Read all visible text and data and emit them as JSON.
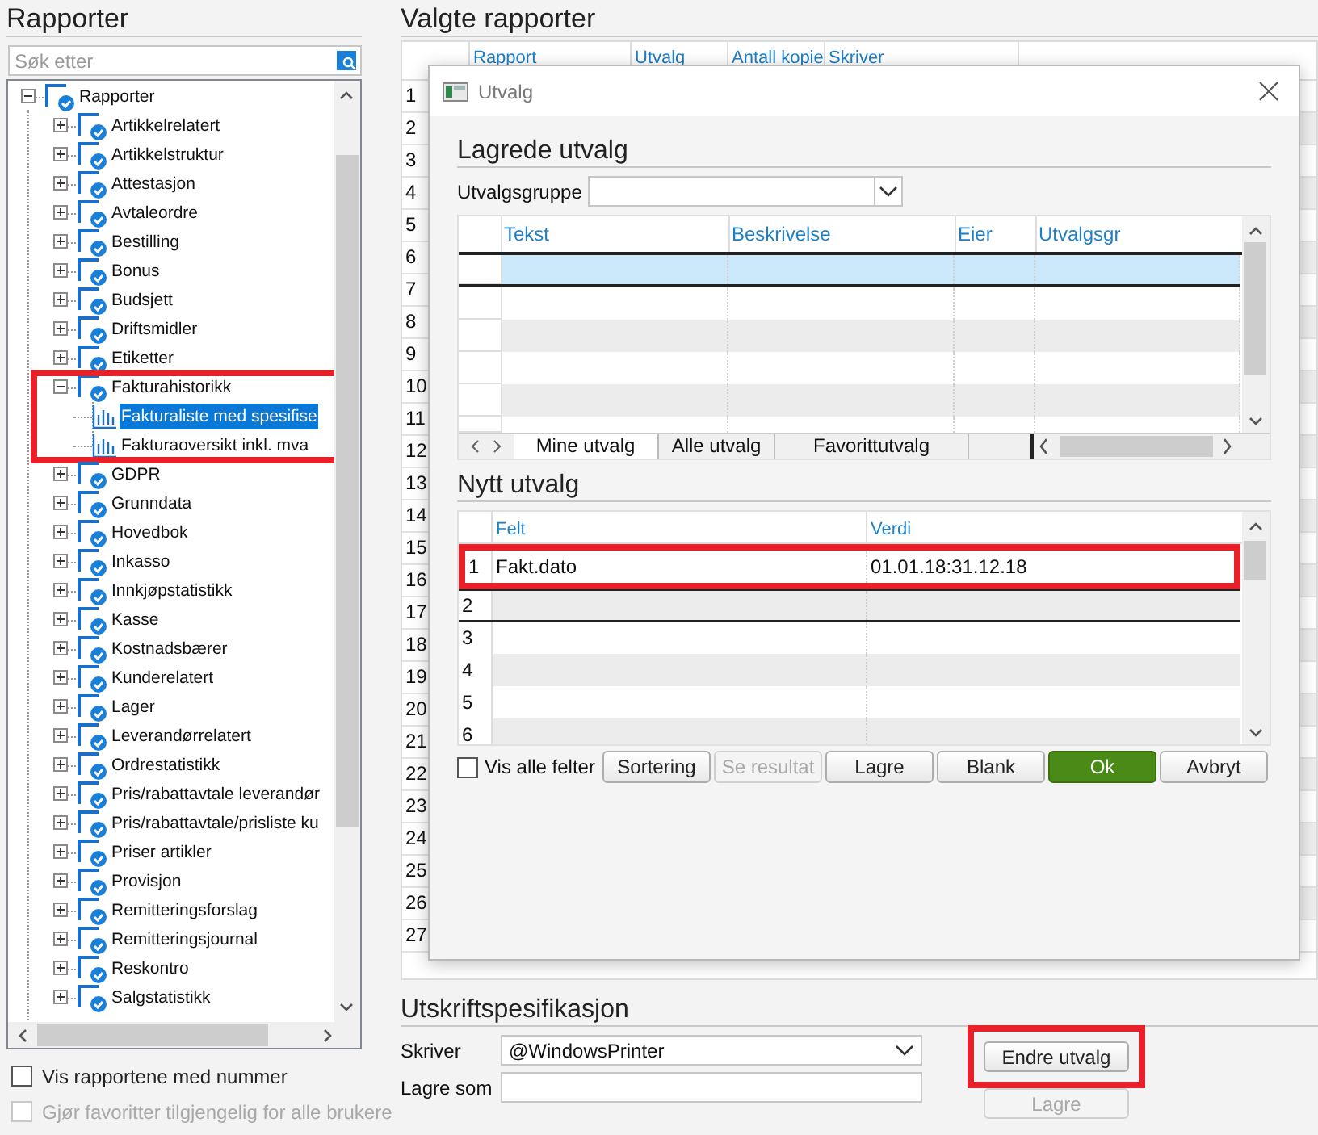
{
  "left_panel": {
    "title": "Rapporter",
    "search": {
      "placeholder": "Søk etter"
    },
    "tree": [
      {
        "label": "Rapporter",
        "kind": "folder",
        "expanded": true,
        "children": [
          {
            "label": "Artikkelrelatert",
            "kind": "folder",
            "expanded": false
          },
          {
            "label": "Artikkelstruktur",
            "kind": "folder",
            "expanded": false
          },
          {
            "label": "Attestasjon",
            "kind": "folder",
            "expanded": false
          },
          {
            "label": "Avtaleordre",
            "kind": "folder",
            "expanded": false
          },
          {
            "label": "Bestilling",
            "kind": "folder",
            "expanded": false
          },
          {
            "label": "Bonus",
            "kind": "folder",
            "expanded": false
          },
          {
            "label": "Budsjett",
            "kind": "folder",
            "expanded": false
          },
          {
            "label": "Driftsmidler",
            "kind": "folder",
            "expanded": false
          },
          {
            "label": "Etiketter",
            "kind": "folder",
            "expanded": false
          },
          {
            "label": "Fakturahistorikk",
            "kind": "folder",
            "expanded": true,
            "highlighted": true,
            "children": [
              {
                "label": "Fakturaliste med spesifise",
                "kind": "report",
                "selected": true
              },
              {
                "label": "Fakturaoversikt inkl. mva",
                "kind": "report",
                "selected": false
              }
            ]
          },
          {
            "label": "GDPR",
            "kind": "folder",
            "expanded": false
          },
          {
            "label": "Grunndata",
            "kind": "folder",
            "expanded": false
          },
          {
            "label": "Hovedbok",
            "kind": "folder",
            "expanded": false
          },
          {
            "label": "Inkasso",
            "kind": "folder",
            "expanded": false
          },
          {
            "label": "Innkjøpstatistikk",
            "kind": "folder",
            "expanded": false
          },
          {
            "label": "Kasse",
            "kind": "folder",
            "expanded": false
          },
          {
            "label": "Kostnadsbærer",
            "kind": "folder",
            "expanded": false
          },
          {
            "label": "Kunderelatert",
            "kind": "folder",
            "expanded": false
          },
          {
            "label": "Lager",
            "kind": "folder",
            "expanded": false
          },
          {
            "label": "Leverandørrelatert",
            "kind": "folder",
            "expanded": false
          },
          {
            "label": "Ordrestatistikk",
            "kind": "folder",
            "expanded": false
          },
          {
            "label": "Pris/rabattavtale leverandør",
            "kind": "folder",
            "expanded": false
          },
          {
            "label": "Pris/rabattavtale/prisliste ku",
            "kind": "folder",
            "expanded": false
          },
          {
            "label": "Priser artikler",
            "kind": "folder",
            "expanded": false
          },
          {
            "label": "Provisjon",
            "kind": "folder",
            "expanded": false
          },
          {
            "label": "Remitteringsforslag",
            "kind": "folder",
            "expanded": false
          },
          {
            "label": "Remitteringsjournal",
            "kind": "folder",
            "expanded": false
          },
          {
            "label": "Reskontro",
            "kind": "folder",
            "expanded": false
          },
          {
            "label": "Salgstatistikk",
            "kind": "folder",
            "expanded": false
          }
        ]
      }
    ],
    "options": [
      {
        "label": "Vis rapportene med nummer",
        "checked": false,
        "disabled": false
      },
      {
        "label": "Gjør favoritter tilgjengelig for alle brukere",
        "checked": false,
        "disabled": true
      }
    ]
  },
  "selected_reports": {
    "title": "Valgte rapporter",
    "columns": [
      "Rapport",
      "Utvalg",
      "Antall kopie",
      "Skriver"
    ],
    "row_numbers": [
      "1",
      "2",
      "3",
      "4",
      "5",
      "6",
      "7",
      "8",
      "9",
      "10",
      "11",
      "12",
      "13",
      "14",
      "15",
      "16",
      "17",
      "18",
      "19",
      "20",
      "21",
      "22",
      "23",
      "24",
      "25",
      "26",
      "27"
    ]
  },
  "dialog": {
    "title": "Utvalg",
    "saved": {
      "title": "Lagrede utvalg",
      "group_label": "Utvalgsgruppe",
      "columns": [
        "Tekst",
        "Beskrivelse",
        "Eier",
        "Utvalgsgr"
      ],
      "rows": [
        {
          "selected": true
        },
        {
          "selected": false
        },
        {
          "selected": false
        },
        {
          "selected": false
        },
        {
          "selected": false
        },
        {
          "selected": false
        }
      ],
      "tabs": [
        {
          "label": "Mine utvalg",
          "selected": true
        },
        {
          "label": "Alle utvalg",
          "selected": false
        },
        {
          "label": "Favorittutvalg",
          "selected": false
        }
      ]
    },
    "new": {
      "title": "Nytt utvalg",
      "columns": [
        "Felt",
        "Verdi"
      ],
      "rows": [
        {
          "number": "1",
          "field": "Fakt.dato",
          "value": "01.01.18:31.12.18",
          "selected": false,
          "highlighted": true
        },
        {
          "number": "2",
          "selected": true,
          "highlighted": false
        },
        {
          "number": "3",
          "selected": false,
          "highlighted": false
        },
        {
          "number": "4",
          "selected": false,
          "highlighted": false
        },
        {
          "number": "5",
          "selected": false,
          "highlighted": false
        },
        {
          "number": "6",
          "selected": false,
          "highlighted": false
        }
      ]
    },
    "show_all": {
      "label": "Vis alle felter",
      "checked": false
    },
    "buttons": [
      {
        "label": "Sortering",
        "kind": "normal",
        "disabled": false
      },
      {
        "label": "Se resultat",
        "kind": "normal",
        "disabled": true
      },
      {
        "label": "Lagre",
        "kind": "normal",
        "disabled": false
      },
      {
        "label": "Blank",
        "kind": "normal",
        "disabled": false
      },
      {
        "label": "Ok",
        "kind": "primary",
        "disabled": false
      },
      {
        "label": "Avbryt",
        "kind": "normal",
        "disabled": false
      }
    ]
  },
  "print_spec": {
    "title": "Utskriftspesifikasjon",
    "printer_label": "Skriver",
    "printer": "@WindowsPrinter",
    "save_as_label": "Lagre som",
    "buttons": [
      {
        "label": "Endre utvalg",
        "disabled": false,
        "highlighted": true
      },
      {
        "label": "Lagre",
        "disabled": true,
        "highlighted": false
      }
    ]
  }
}
